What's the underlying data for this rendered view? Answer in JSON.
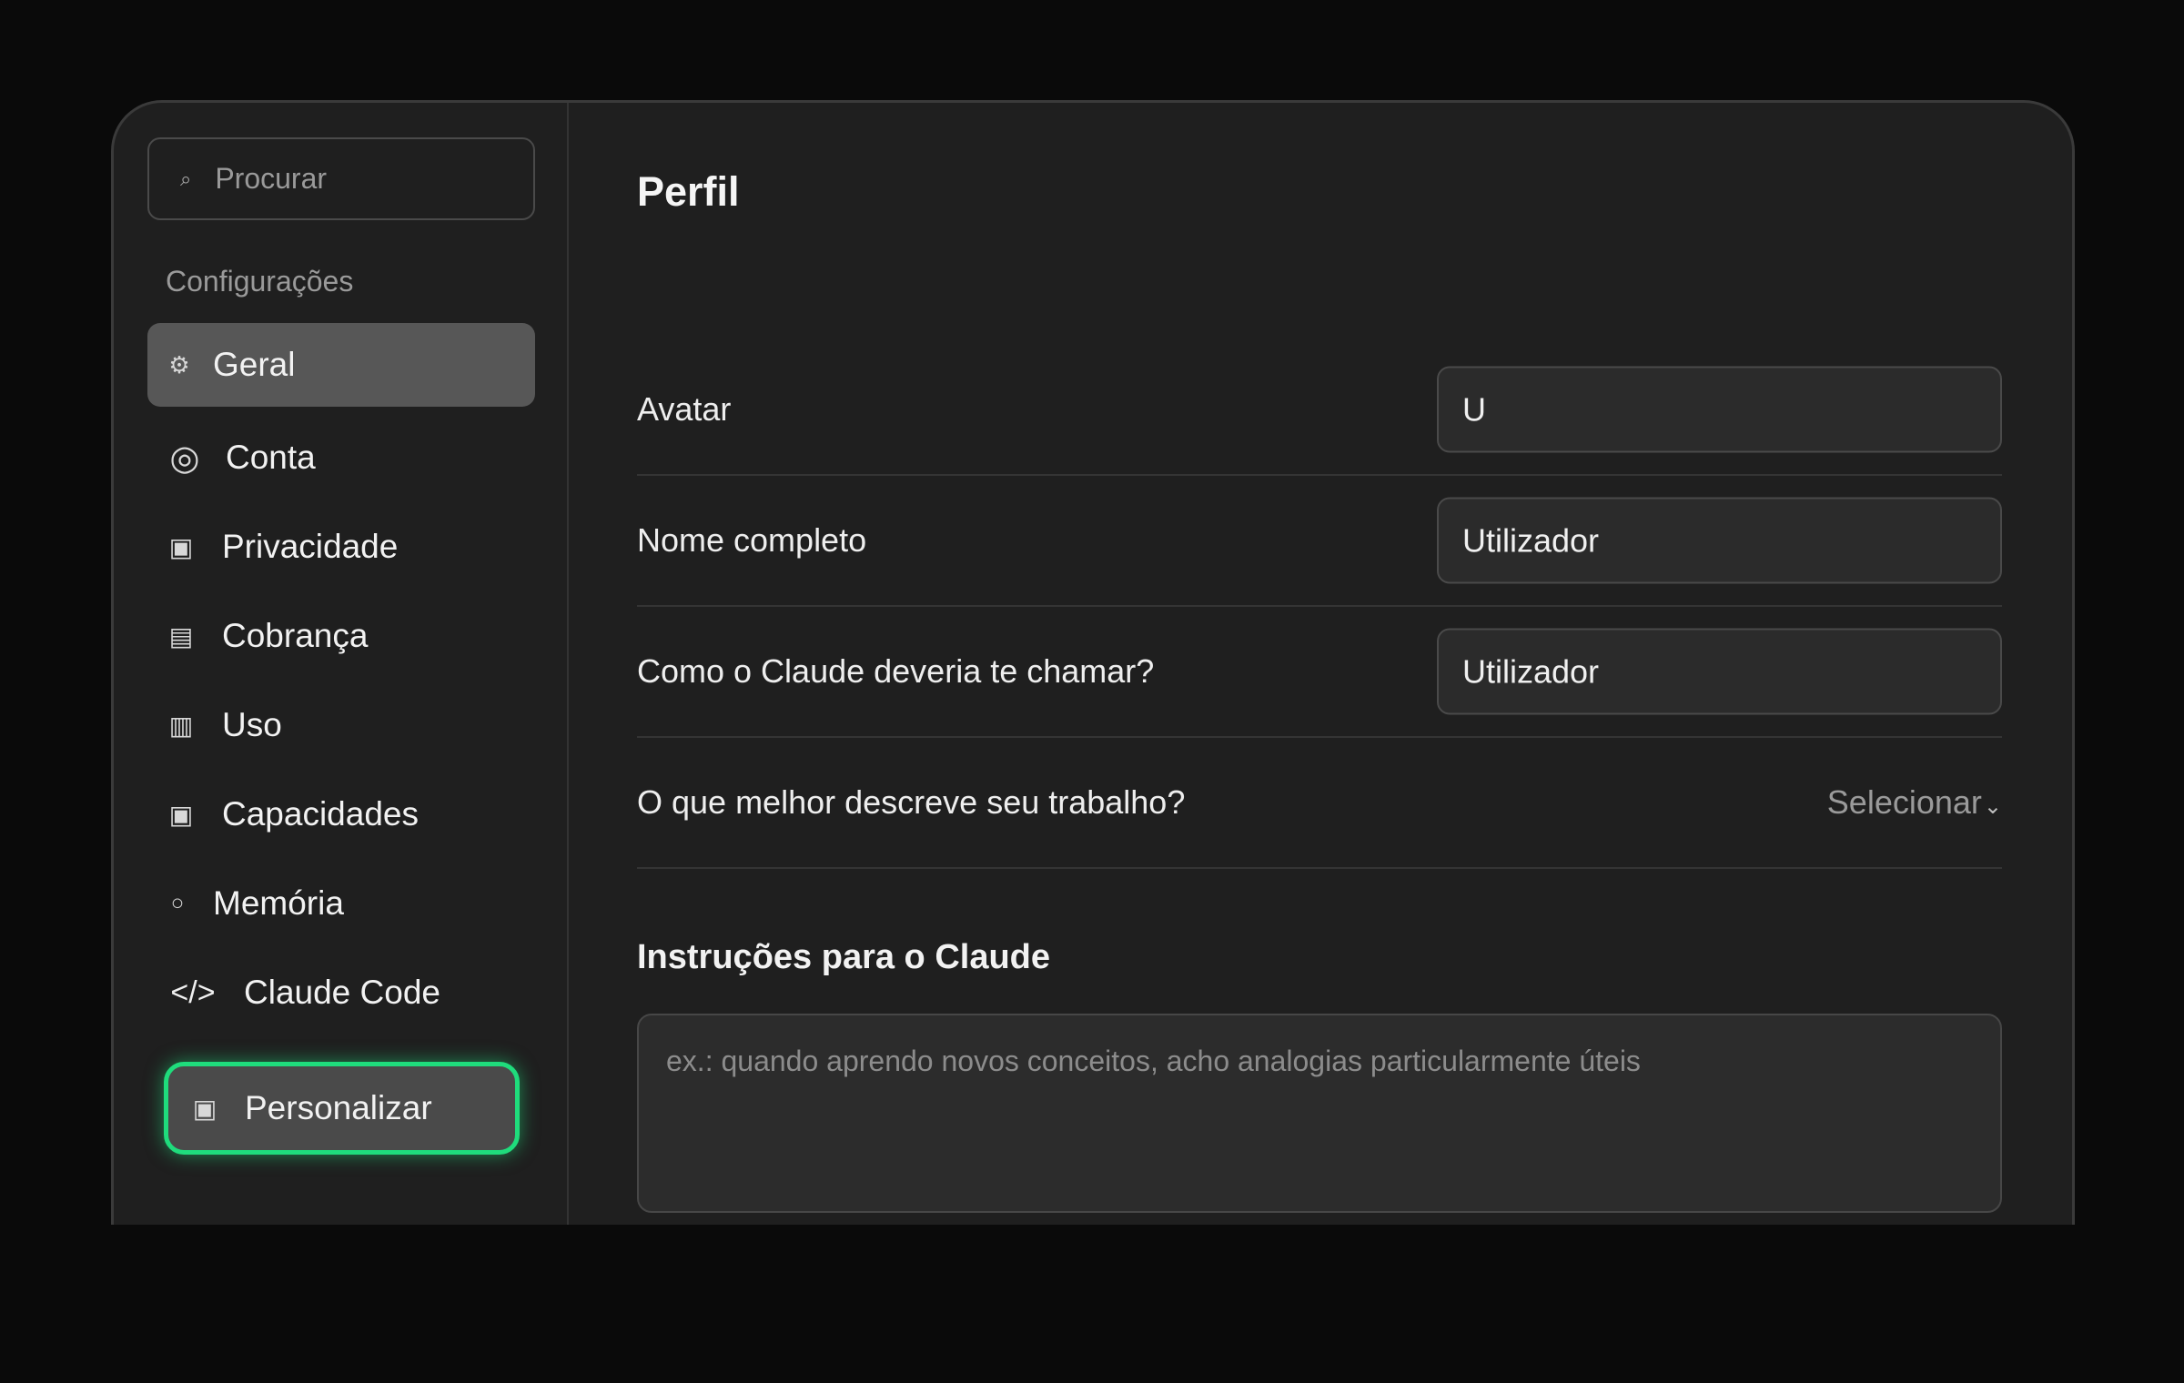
{
  "sidebar": {
    "search_placeholder": "Procurar",
    "section_label": "Configurações",
    "items": [
      {
        "label": "Geral",
        "icon": "⚙"
      },
      {
        "label": "Conta",
        "icon": "◎"
      },
      {
        "label": "Privacidade",
        "icon": "▣"
      },
      {
        "label": "Cobrança",
        "icon": "▤"
      },
      {
        "label": "Uso",
        "icon": "▥"
      },
      {
        "label": "Capacidades",
        "icon": "▣"
      },
      {
        "label": "Memória",
        "icon": "○"
      },
      {
        "label": "Claude Code",
        "icon": "</>"
      },
      {
        "label": "Personalizar",
        "icon": "▣"
      }
    ]
  },
  "main": {
    "title": "Perfil",
    "avatar_label": "Avatar",
    "avatar_value": "U",
    "full_name_label": "Nome completo",
    "full_name_value": "Utilizador",
    "call_name_label": "Como o Claude deveria te chamar?",
    "call_name_value": "Utilizador",
    "work_label": "O que melhor descreve seu trabalho?",
    "work_select": "Selecionar",
    "work_chevron": "⌄",
    "instructions_title": "Instruções para o Claude",
    "instructions_placeholder": "ex.: quando aprendo novos conceitos, acho analogias particularmente úteis"
  },
  "colors": {
    "highlight": "#1fdc7c",
    "active_bg": "#575757"
  }
}
